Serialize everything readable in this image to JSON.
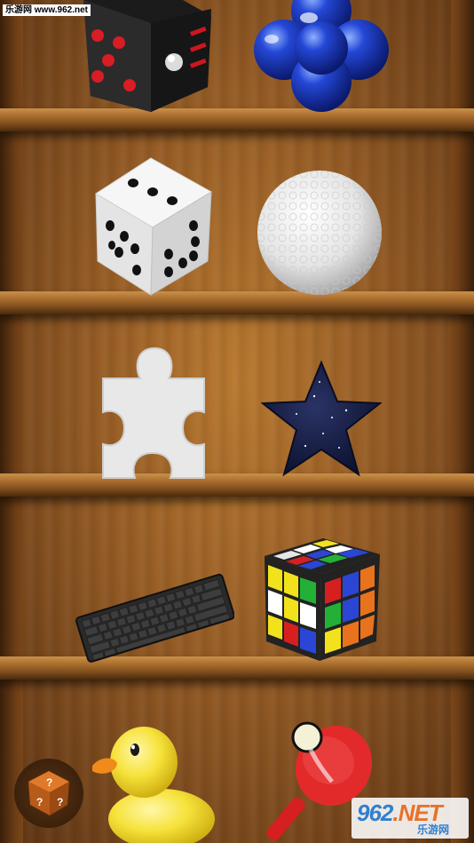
{
  "watermark": {
    "text": "乐游网 www.962.net"
  },
  "brand": {
    "big_prefix": "962",
    "big_suffix": ".NET",
    "subtitle": "乐游网"
  },
  "shelves": {
    "row1": [
      "fidget-cube",
      "blue-bubble-ball"
    ],
    "row2": [
      "white-dice",
      "golf-ball"
    ],
    "row3": [
      "puzzle-piece",
      "starry-star"
    ],
    "row4": [
      "keyboard",
      "rubiks-cube"
    ],
    "row5": [
      "rubber-duck",
      "ping-pong-paddle"
    ]
  },
  "hint_button": {
    "icon": "question-dice-icon"
  },
  "colors": {
    "wood": "#a86c2d",
    "accent_red": "#e22a2a",
    "blue": "#1f48c8"
  }
}
